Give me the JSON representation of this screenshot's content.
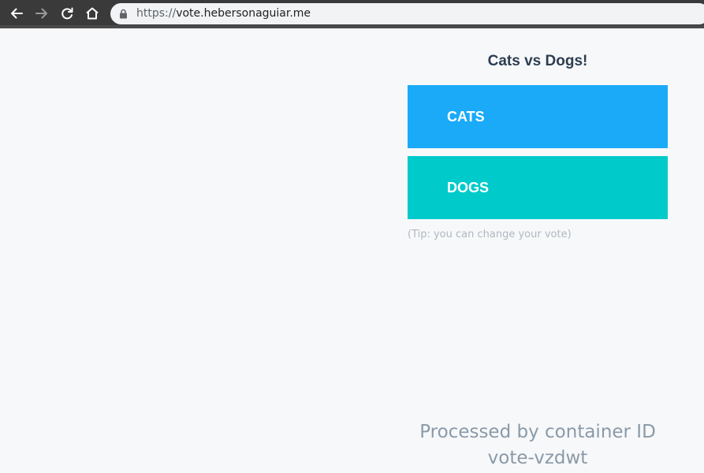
{
  "browser": {
    "url_scheme": "https://",
    "url_host": "vote.hebersonaguiar.me",
    "icons": [
      "back-arrow-icon",
      "forward-arrow-icon",
      "reload-icon",
      "home-icon",
      "lock-icon"
    ]
  },
  "page": {
    "title": "Cats vs Dogs!",
    "options": [
      {
        "label": "CATS",
        "color": "#1aaaf8"
      },
      {
        "label": "DOGS",
        "color": "#00cbca"
      }
    ],
    "tip": "(Tip: you can change your vote)",
    "footer_line1": "Processed by container ID",
    "footer_line2": "vote-vzdwt"
  }
}
